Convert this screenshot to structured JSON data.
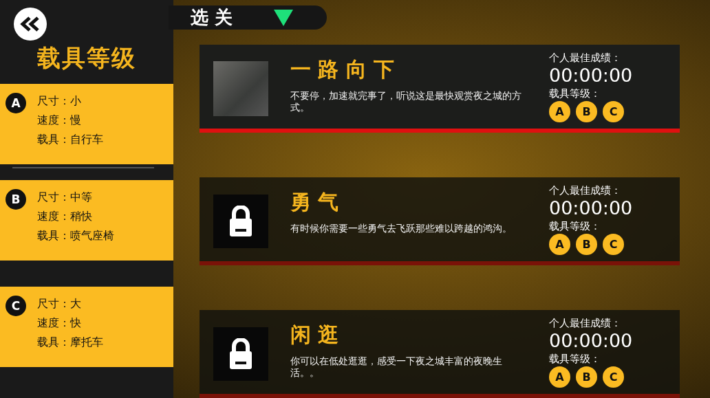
{
  "sidebar": {
    "title": "载具等级",
    "classes": [
      {
        "grade": "A",
        "lines": [
          "尺寸：小",
          "速度：慢",
          "载具：自行车"
        ]
      },
      {
        "grade": "B",
        "lines": [
          "尺寸：中等",
          "速度：稍快",
          "载具：喷气座椅"
        ]
      },
      {
        "grade": "C",
        "lines": [
          "尺寸：大",
          "速度：快",
          "载具：摩托车"
        ]
      }
    ]
  },
  "header": {
    "title": "选 关"
  },
  "levels": [
    {
      "title": "一 路 向 下",
      "description": "不要停，加速就完事了，听说这是最快观赏夜之城的方式。",
      "locked": false,
      "best_label": "个人最佳成绩：",
      "best_time": "00:00:00",
      "grade_label": "载具等级：",
      "grades": [
        "A",
        "B",
        "C"
      ]
    },
    {
      "title": "勇 气",
      "description": "有时候你需要一些勇气去飞跃那些难以跨越的鸿沟。",
      "locked": true,
      "best_label": "个人最佳成绩：",
      "best_time": "00:00:00",
      "grade_label": "载具等级：",
      "grades": [
        "A",
        "B",
        "C"
      ]
    },
    {
      "title": "闲 逛",
      "description": "你可以在低处逛逛，感受一下夜之城丰富的夜晚生活。。",
      "locked": true,
      "best_label": "个人最佳成绩：",
      "best_time": "00:00:00",
      "grade_label": "载具等级：",
      "grades": [
        "A",
        "B",
        "C"
      ]
    }
  ]
}
